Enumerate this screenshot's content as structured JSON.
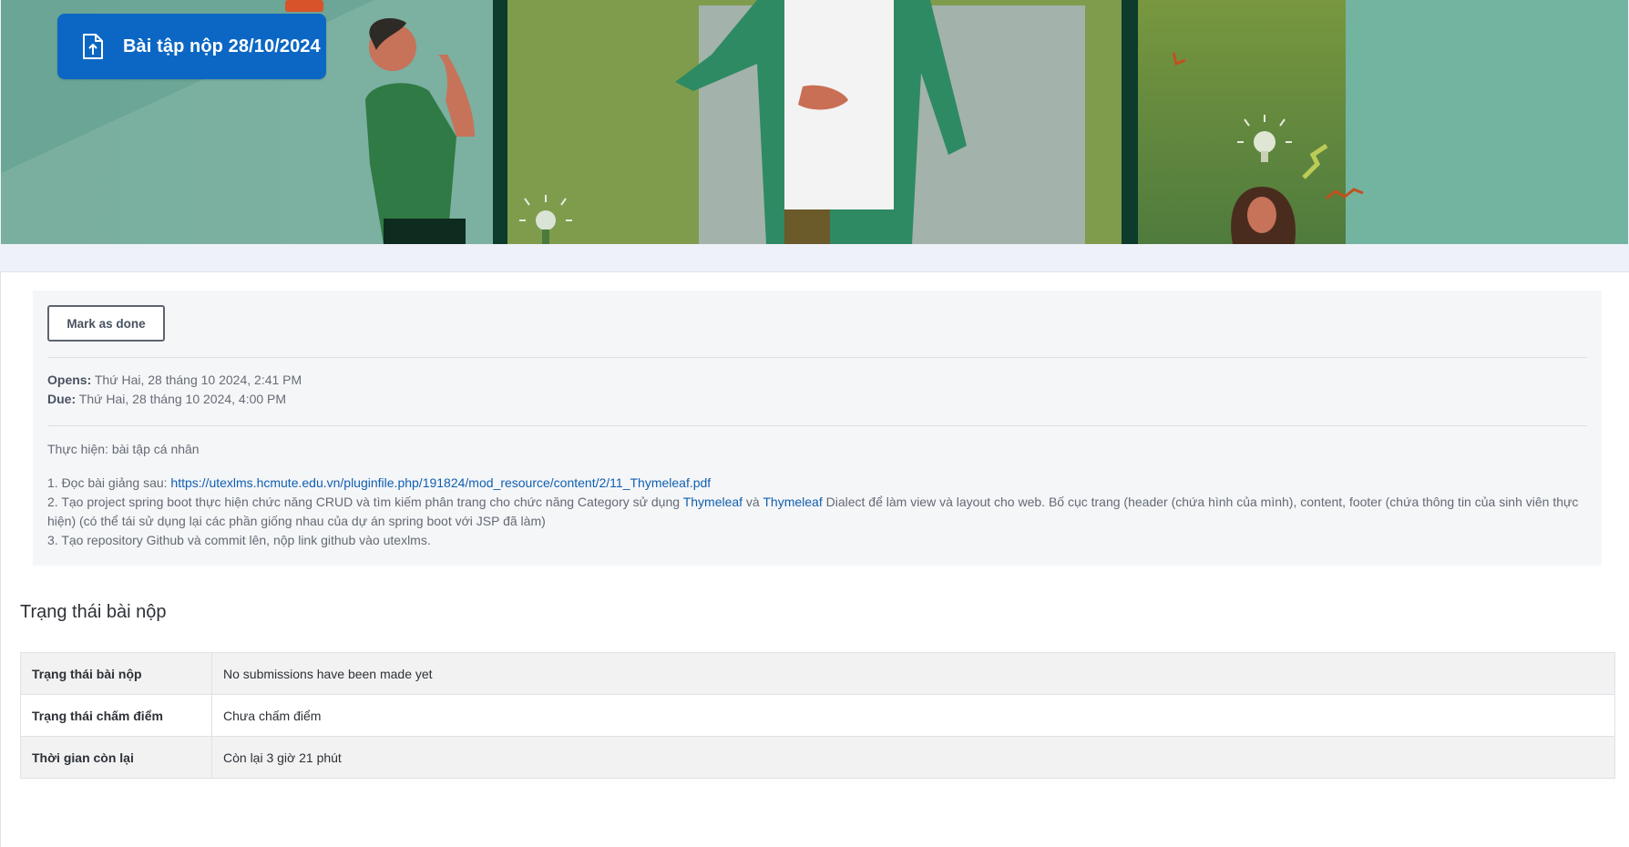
{
  "header": {
    "title": "Bài tập nộp 28/10/2024",
    "icon": "file-upload-icon",
    "badge_color": "#0c67c4"
  },
  "activity": {
    "mark_done_label": "Mark as done",
    "opens_label": "Opens:",
    "opens_value": "Thứ Hai, 28 tháng 10 2024, 2:41 PM",
    "due_label": "Due:",
    "due_value": "Thứ Hai, 28 tháng 10 2024, 4:00 PM",
    "description": {
      "intro": "Thực hiện: bài tập cá nhân",
      "item1_prefix": "1. Đọc bài giảng sau: ",
      "item1_link": "https://utexlms.hcmute.edu.vn/pluginfile.php/191824/mod_resource/content/2/11_Thymeleaf.pdf",
      "item2_a": "2. Tạo project spring boot thực hiện chức năng CRUD và tìm kiếm phân trang cho chức năng Category sử dụng ",
      "item2_link1": "Thymeleaf",
      "item2_b": " và ",
      "item2_link2": "Thymeleaf",
      "item2_c": " Dialect để làm view và layout cho web. Bố cục trang (header (chứa hình của mình), content, footer (chứa thông tin của sinh viên thực hiện) (có thể tái sử dụng lại các phần giống nhau của dự án spring boot với JSP đã làm)",
      "item3": "3. Tạo repository Github và commit lên, nộp link github vào utexlms."
    }
  },
  "submission": {
    "section_title": "Trạng thái bài nộp",
    "rows": [
      {
        "label": "Trạng thái bài nộp",
        "value": "No submissions have been made yet"
      },
      {
        "label": "Trạng thái chấm điểm",
        "value": "Chưa chấm điểm"
      },
      {
        "label": "Thời gian còn lại",
        "value": "Còn lại 3 giờ 21 phút"
      }
    ]
  }
}
